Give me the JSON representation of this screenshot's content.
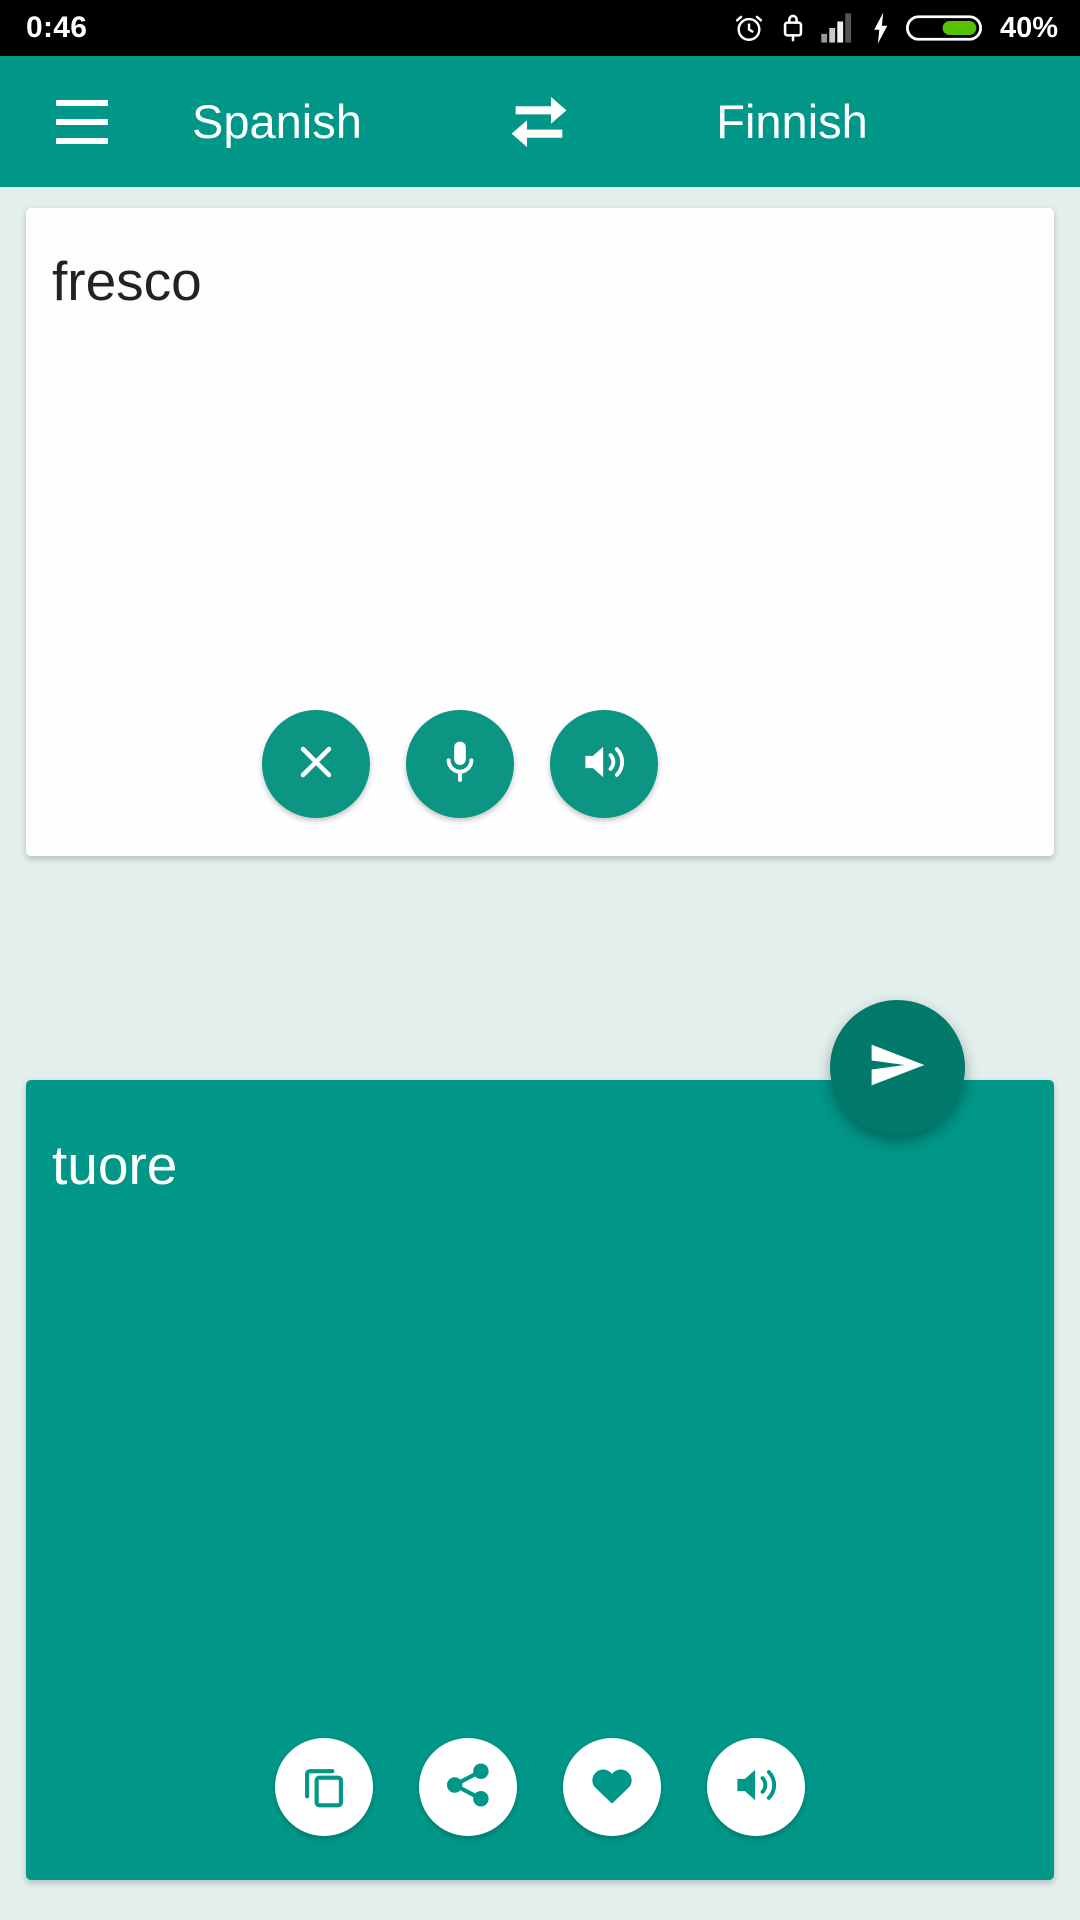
{
  "status_bar": {
    "time": "0:46",
    "battery_percent": "40%",
    "icons": [
      "alarm-clock-icon",
      "usb-lock-icon",
      "signal-bars-icon",
      "charging-bolt-icon",
      "battery-icon"
    ],
    "background_color": "#000000",
    "text_color": "#ffffff",
    "battery_fill_color": "#57c000"
  },
  "app_bar": {
    "menu_label": "menu",
    "source_language": "Spanish",
    "target_language": "Finnish",
    "swap_label": "swap languages",
    "background_color": "#009688",
    "text_color": "#ffffff"
  },
  "source_card": {
    "text": "fresco",
    "background_color": "#fefefe",
    "text_color": "#222222",
    "actions": [
      {
        "name": "clear-button",
        "icon": "close-icon",
        "label": "Clear"
      },
      {
        "name": "microphone-button",
        "icon": "microphone-icon",
        "label": "Voice input"
      },
      {
        "name": "speak-source-button",
        "icon": "speaker-icon",
        "label": "Listen"
      }
    ],
    "button_color": "#0d9584",
    "button_icon_color": "#ffffff"
  },
  "send_button": {
    "name": "translate-send-button",
    "icon": "send-icon",
    "label": "Translate",
    "background_color": "#00796b",
    "icon_color": "#ffffff"
  },
  "target_card": {
    "text": "tuore",
    "background_color": "#009688",
    "text_color": "#ffffff",
    "actions": [
      {
        "name": "copy-button",
        "icon": "copy-icon",
        "label": "Copy"
      },
      {
        "name": "share-button",
        "icon": "share-icon",
        "label": "Share"
      },
      {
        "name": "favorite-button",
        "icon": "heart-icon",
        "label": "Favorite"
      },
      {
        "name": "speak-target-button",
        "icon": "speaker-icon",
        "label": "Listen"
      }
    ],
    "button_color": "#ffffff",
    "button_icon_color": "#009688"
  },
  "page": {
    "background_color": "#e2efec"
  }
}
